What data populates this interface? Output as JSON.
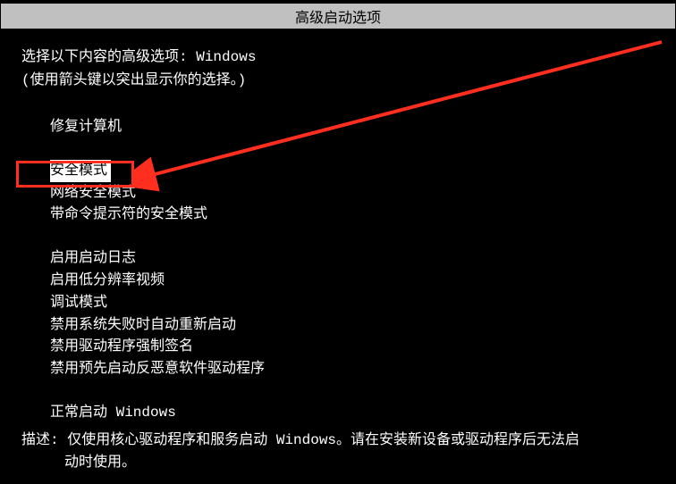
{
  "title": "高级启动选项",
  "instruction_prefix": "选择以下内容的高级选项: ",
  "instruction_target": "Windows",
  "hint": "(使用箭头键以突出显示你的选择。)",
  "options": {
    "repair": "修复计算机",
    "safe_mode": "安全模式",
    "safe_mode_network": "网络安全模式",
    "safe_mode_cmd": "带命令提示符的安全模式",
    "boot_log": "启用启动日志",
    "low_res": "启用低分辨率视频",
    "debug": "调试模式",
    "disable_restart": "禁用系统失败时自动重新启动",
    "disable_sig": "禁用驱动程序强制签名",
    "disable_elam": "禁用预先启动反恶意软件驱动程序",
    "normal": "正常启动 Windows"
  },
  "description": {
    "label": "描述:",
    "line1": "仅使用核心驱动程序和服务启动 Windows。请在安装新设备或驱动程序后无法启",
    "line2": "动时使用。"
  }
}
